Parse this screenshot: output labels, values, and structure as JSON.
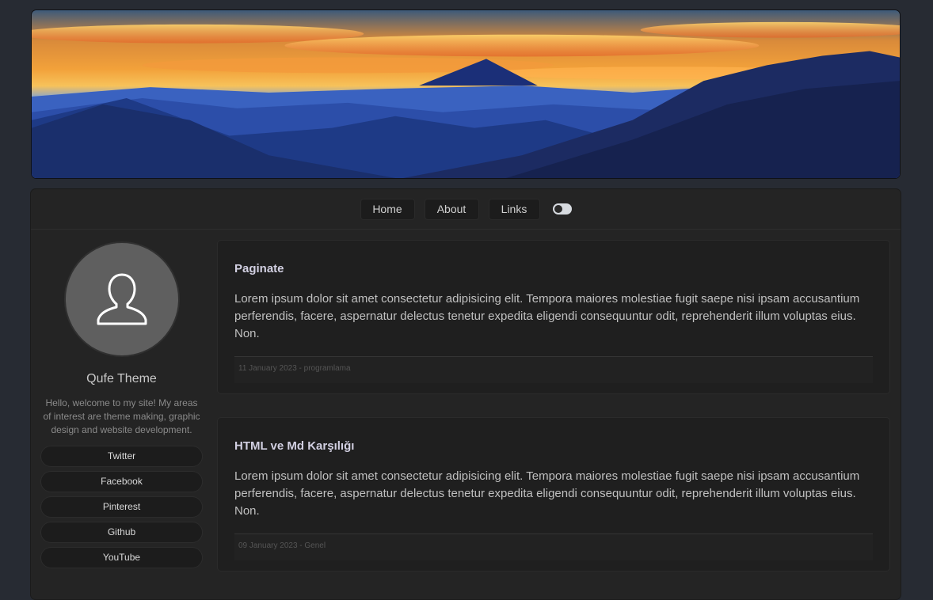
{
  "nav": {
    "items": [
      "Home",
      "About",
      "Links"
    ],
    "theme_toggle_icon": "toggle-icon"
  },
  "sidebar": {
    "avatar_icon": "user-icon",
    "site_name": "Qufe Theme",
    "bio": "Hello, welcome to my site! My areas of interest are theme making, graphic design and website development.",
    "social": [
      "Twitter",
      "Facebook",
      "Pinterest",
      "Github",
      "YouTube"
    ]
  },
  "posts": [
    {
      "title": "Paginate",
      "body": "Lorem ipsum dolor sit amet consectetur adipisicing elit. Tempora maiores molestiae fugit saepe nisi ipsam accusantium perferendis, facere, aspernatur delectus tenetur expedita eligendi consequuntur odit, reprehenderit illum voluptas eius. Non.",
      "meta": "11 January 2023 - programlama"
    },
    {
      "title": "HTML ve Md Karşılığı",
      "body": "Lorem ipsum dolor sit amet consectetur adipisicing elit. Tempora maiores molestiae fugit saepe nisi ipsam accusantium perferendis, facere, aspernatur delectus tenetur expedita eligendi consequuntur odit, reprehenderit illum voluptas eius. Non.",
      "meta": "09 January 2023 - Genel"
    }
  ],
  "colors": {
    "page_bg": "#272b33",
    "panel_bg": "#242424",
    "card_bg": "#1f1f1f",
    "title_color": "#d2d0e2"
  }
}
